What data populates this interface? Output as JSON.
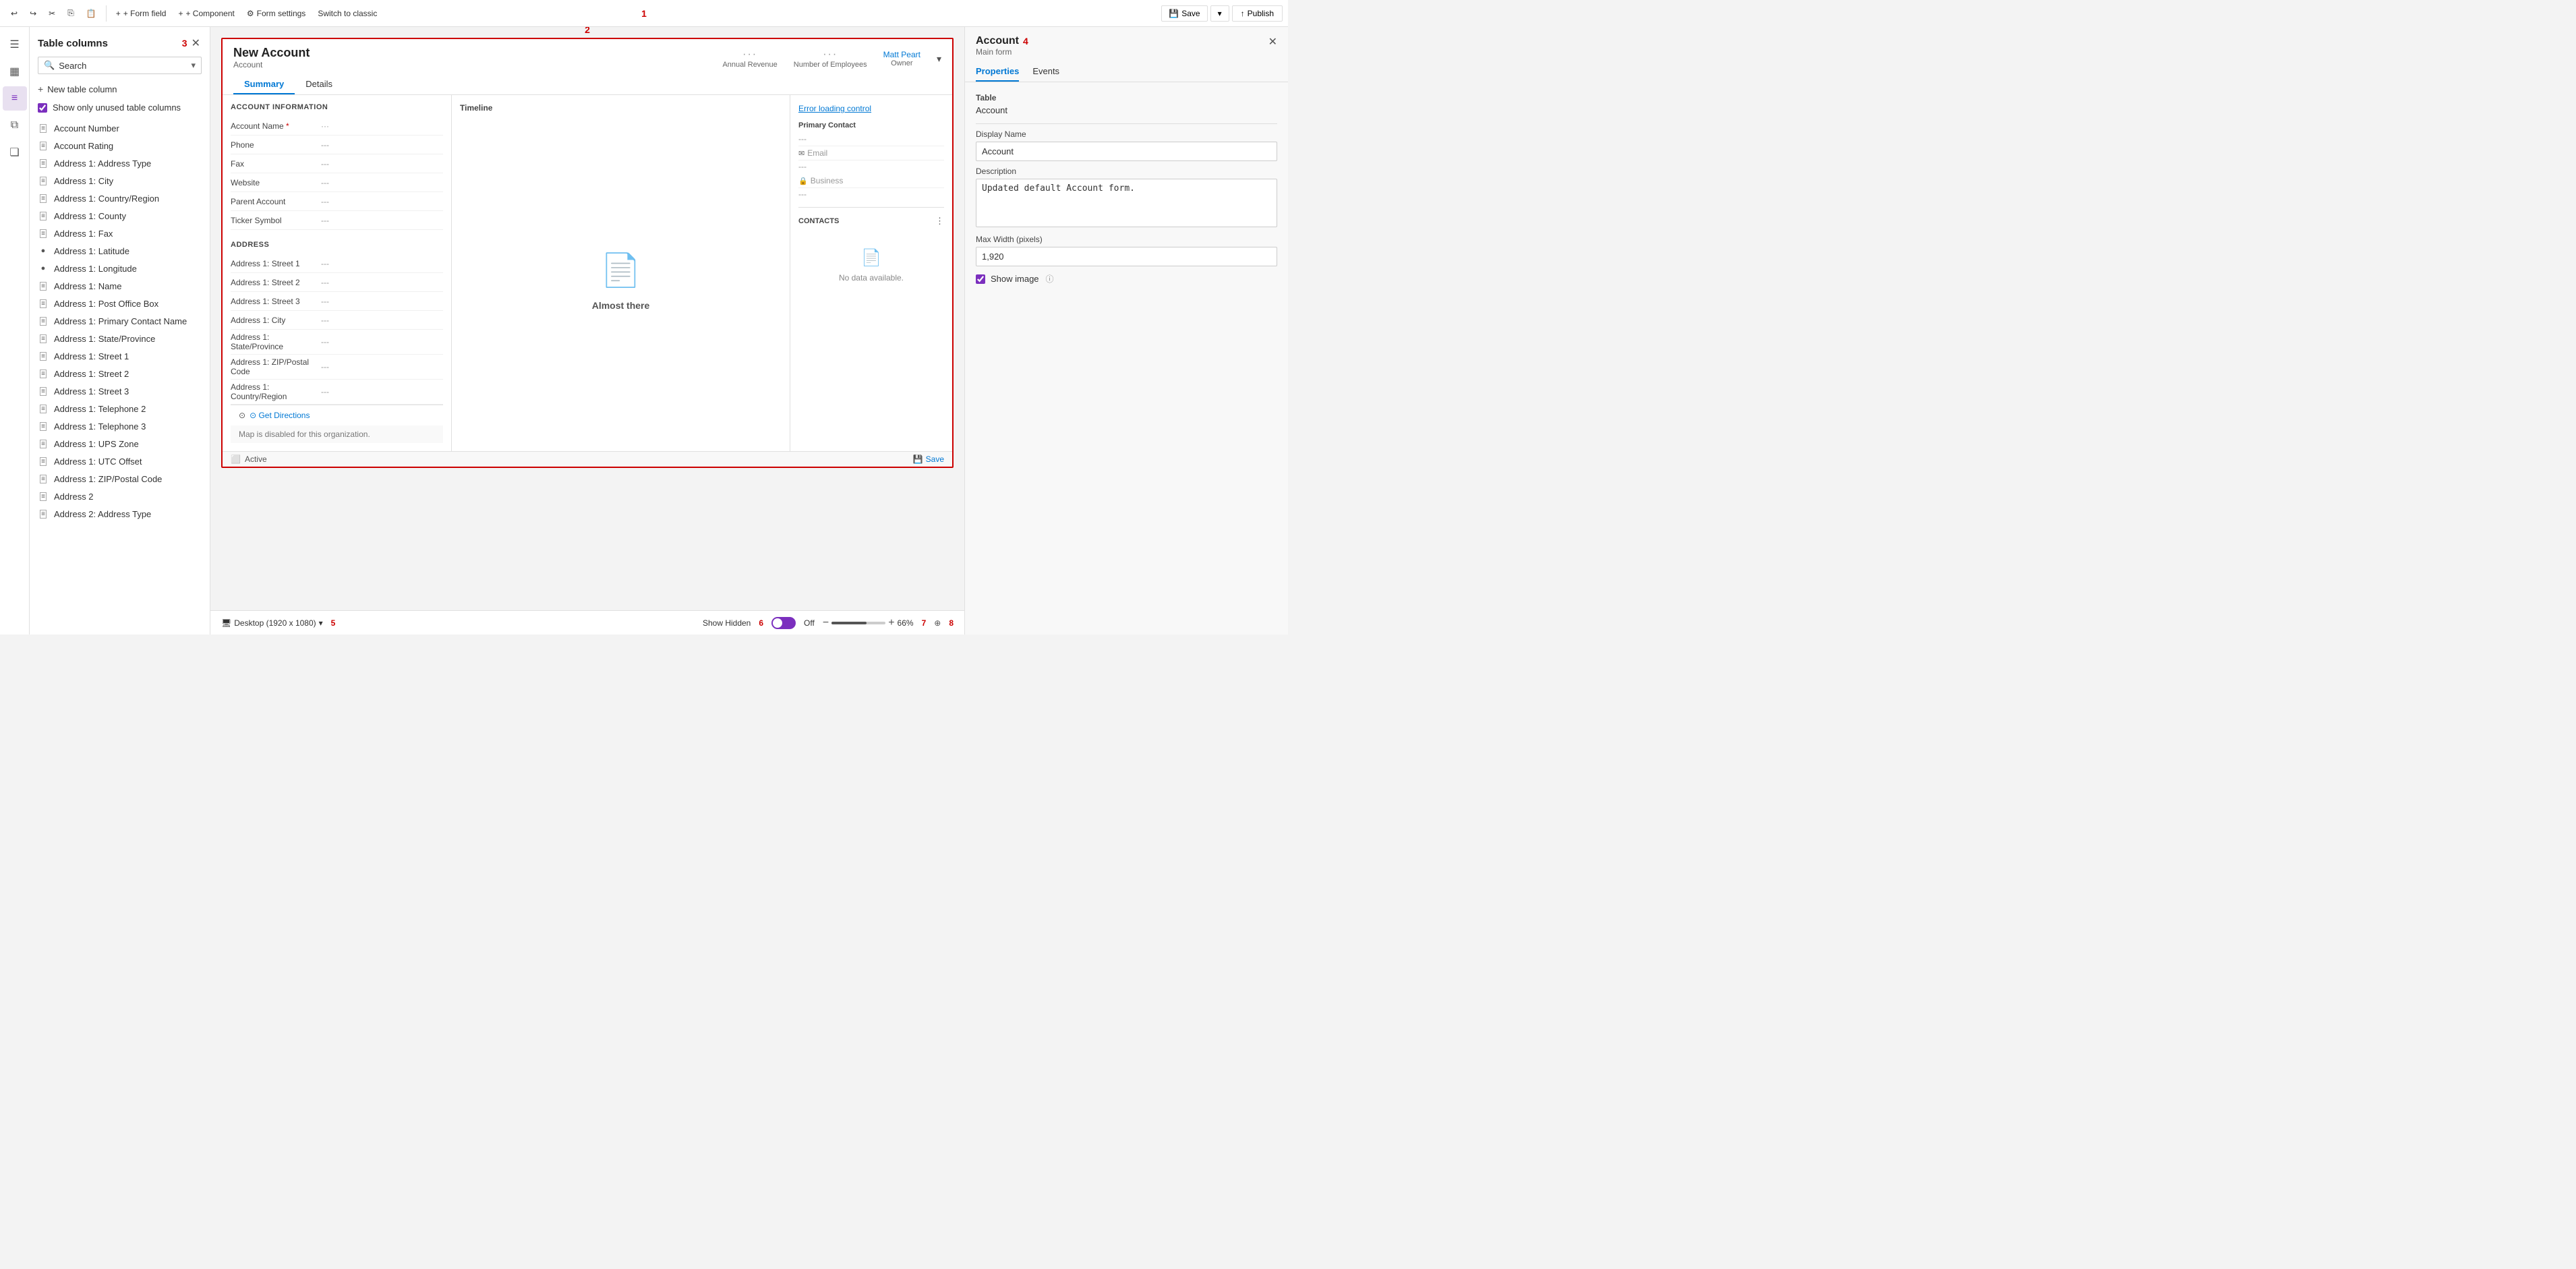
{
  "toolbar": {
    "undo_title": "Undo",
    "redo_title": "Redo",
    "cut_title": "Cut",
    "copy_title": "Copy",
    "paste_title": "Paste",
    "form_field_label": "+ Form field",
    "component_label": "+ Component",
    "form_settings_label": "Form settings",
    "switch_label": "Switch to classic",
    "save_label": "Save",
    "publish_label": "Publish",
    "red_label": "1"
  },
  "sidebar": {
    "icons": [
      {
        "name": "hamburger-icon",
        "symbol": "☰",
        "active": false
      },
      {
        "name": "fields-icon",
        "symbol": "▦",
        "active": false
      },
      {
        "name": "active-icon",
        "symbol": "≡",
        "active": true
      },
      {
        "name": "layers-icon",
        "symbol": "⧉",
        "active": false
      },
      {
        "name": "components-icon",
        "symbol": "❏",
        "active": false
      }
    ]
  },
  "table_columns": {
    "title": "Table columns",
    "search_placeholder": "Search",
    "new_column_label": "New table column",
    "show_unused_label": "Show only unused table columns",
    "show_unused_checked": true,
    "red_label": "3",
    "columns": [
      {
        "icon": "text-icon",
        "label": "Account Number"
      },
      {
        "icon": "text-icon",
        "label": "Account Rating"
      },
      {
        "icon": "text-icon",
        "label": "Address 1: Address Type"
      },
      {
        "icon": "text-icon",
        "label": "Address 1: City"
      },
      {
        "icon": "text-icon",
        "label": "Address 1: Country/Region"
      },
      {
        "icon": "text-icon",
        "label": "Address 1: County"
      },
      {
        "icon": "text-icon",
        "label": "Address 1: Fax"
      },
      {
        "icon": "globe-icon",
        "label": "Address 1: Latitude"
      },
      {
        "icon": "globe-icon",
        "label": "Address 1: Longitude"
      },
      {
        "icon": "text-icon",
        "label": "Address 1: Name"
      },
      {
        "icon": "text-icon",
        "label": "Address 1: Post Office Box"
      },
      {
        "icon": "text-icon",
        "label": "Address 1: Primary Contact Name"
      },
      {
        "icon": "text-icon",
        "label": "Address 1: State/Province"
      },
      {
        "icon": "text-icon",
        "label": "Address 1: Street 1"
      },
      {
        "icon": "text-icon",
        "label": "Address 1: Street 2"
      },
      {
        "icon": "text-icon",
        "label": "Address 1: Street 3"
      },
      {
        "icon": "text-icon",
        "label": "Address 1: Telephone 2"
      },
      {
        "icon": "text-icon",
        "label": "Address 1: Telephone 3"
      },
      {
        "icon": "text-icon",
        "label": "Address 1: UPS Zone"
      },
      {
        "icon": "text-icon",
        "label": "Address 1: UTC Offset"
      },
      {
        "icon": "text-icon",
        "label": "Address 1: ZIP/Postal Code"
      },
      {
        "icon": "text-icon",
        "label": "Address 2"
      },
      {
        "icon": "text-icon",
        "label": "Address 2: Address Type"
      }
    ]
  },
  "form": {
    "title": "New Account",
    "subtitle": "Account",
    "tab_summary": "Summary",
    "tab_details": "Details",
    "meta": [
      {
        "dots": "···",
        "label": "Annual Revenue"
      },
      {
        "dots": "···",
        "label": "Number of Employees"
      },
      {
        "owner": "Matt Peart",
        "label": "Owner"
      }
    ],
    "sections": {
      "account_info": {
        "title": "ACCOUNT INFORMATION",
        "fields": [
          {
            "label": "Account Name",
            "required": true,
            "value": "···"
          },
          {
            "label": "Phone",
            "value": "---"
          },
          {
            "label": "Fax",
            "value": "---"
          },
          {
            "label": "Website",
            "value": "---"
          },
          {
            "label": "Parent Account",
            "value": "---"
          },
          {
            "label": "Ticker Symbol",
            "value": "---"
          }
        ]
      },
      "timeline": {
        "title": "Timeline",
        "icon": "📄",
        "almost_there": "Almost there"
      },
      "right_panel": {
        "error_text": "Error loading control",
        "primary_contact": {
          "label": "Primary Contact",
          "value": "---"
        },
        "email": {
          "label": "Email",
          "value": "---"
        },
        "business": {
          "label": "Business",
          "value": "---"
        },
        "contacts": {
          "title": "CONTACTS",
          "no_data": "No data available."
        }
      },
      "address": {
        "title": "ADDRESS",
        "fields": [
          {
            "label": "Address 1: Street 1",
            "value": "---"
          },
          {
            "label": "Address 1: Street 2",
            "value": "---"
          },
          {
            "label": "Address 1: Street 3",
            "value": "---"
          },
          {
            "label": "Address 1: City",
            "value": "---"
          },
          {
            "label": "Address 1:\nState/Province",
            "value": "---"
          },
          {
            "label": "Address 1: ZIP/Postal Code",
            "value": "---"
          },
          {
            "label": "Address 1:\nCountry/Region",
            "value": "---"
          }
        ]
      }
    },
    "map_text": "Map is disabled for this organization.",
    "get_directions": "⊙ Get Directions",
    "status": "Active",
    "save_label": "Save",
    "red_label": "2"
  },
  "properties": {
    "title": "Account",
    "subtitle": "Main form",
    "tab_properties": "Properties",
    "tab_events": "Events",
    "table_label": "Table",
    "table_value": "Account",
    "display_name_label": "Display Name",
    "display_name_value": "Account",
    "description_label": "Description",
    "description_value": "Updated default Account form.",
    "max_width_label": "Max Width (pixels)",
    "max_width_value": "1,920",
    "show_image_label": "Show image",
    "show_image_checked": true,
    "red_label": "4"
  },
  "bottom_bar": {
    "device_label": "Desktop (1920 x 1080)",
    "show_hidden_label": "Show Hidden",
    "off_label": "Off",
    "zoom_pct": "66%",
    "red_label_5": "5",
    "red_label_6": "6",
    "red_label_7": "7",
    "red_label_8": "8"
  }
}
